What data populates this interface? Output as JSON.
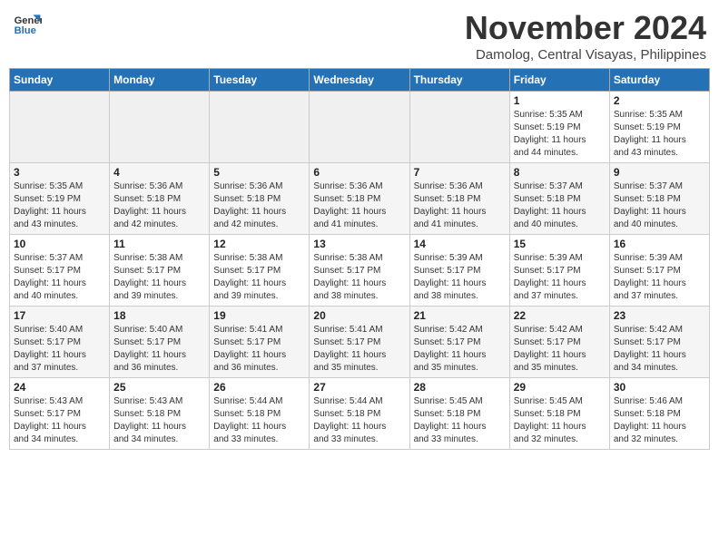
{
  "header": {
    "logo_line1": "General",
    "logo_line2": "Blue",
    "month": "November 2024",
    "location": "Damolog, Central Visayas, Philippines"
  },
  "weekdays": [
    "Sunday",
    "Monday",
    "Tuesday",
    "Wednesday",
    "Thursday",
    "Friday",
    "Saturday"
  ],
  "weeks": [
    [
      {
        "day": "",
        "info": ""
      },
      {
        "day": "",
        "info": ""
      },
      {
        "day": "",
        "info": ""
      },
      {
        "day": "",
        "info": ""
      },
      {
        "day": "",
        "info": ""
      },
      {
        "day": "1",
        "info": "Sunrise: 5:35 AM\nSunset: 5:19 PM\nDaylight: 11 hours\nand 44 minutes."
      },
      {
        "day": "2",
        "info": "Sunrise: 5:35 AM\nSunset: 5:19 PM\nDaylight: 11 hours\nand 43 minutes."
      }
    ],
    [
      {
        "day": "3",
        "info": "Sunrise: 5:35 AM\nSunset: 5:19 PM\nDaylight: 11 hours\nand 43 minutes."
      },
      {
        "day": "4",
        "info": "Sunrise: 5:36 AM\nSunset: 5:18 PM\nDaylight: 11 hours\nand 42 minutes."
      },
      {
        "day": "5",
        "info": "Sunrise: 5:36 AM\nSunset: 5:18 PM\nDaylight: 11 hours\nand 42 minutes."
      },
      {
        "day": "6",
        "info": "Sunrise: 5:36 AM\nSunset: 5:18 PM\nDaylight: 11 hours\nand 41 minutes."
      },
      {
        "day": "7",
        "info": "Sunrise: 5:36 AM\nSunset: 5:18 PM\nDaylight: 11 hours\nand 41 minutes."
      },
      {
        "day": "8",
        "info": "Sunrise: 5:37 AM\nSunset: 5:18 PM\nDaylight: 11 hours\nand 40 minutes."
      },
      {
        "day": "9",
        "info": "Sunrise: 5:37 AM\nSunset: 5:18 PM\nDaylight: 11 hours\nand 40 minutes."
      }
    ],
    [
      {
        "day": "10",
        "info": "Sunrise: 5:37 AM\nSunset: 5:17 PM\nDaylight: 11 hours\nand 40 minutes."
      },
      {
        "day": "11",
        "info": "Sunrise: 5:38 AM\nSunset: 5:17 PM\nDaylight: 11 hours\nand 39 minutes."
      },
      {
        "day": "12",
        "info": "Sunrise: 5:38 AM\nSunset: 5:17 PM\nDaylight: 11 hours\nand 39 minutes."
      },
      {
        "day": "13",
        "info": "Sunrise: 5:38 AM\nSunset: 5:17 PM\nDaylight: 11 hours\nand 38 minutes."
      },
      {
        "day": "14",
        "info": "Sunrise: 5:39 AM\nSunset: 5:17 PM\nDaylight: 11 hours\nand 38 minutes."
      },
      {
        "day": "15",
        "info": "Sunrise: 5:39 AM\nSunset: 5:17 PM\nDaylight: 11 hours\nand 37 minutes."
      },
      {
        "day": "16",
        "info": "Sunrise: 5:39 AM\nSunset: 5:17 PM\nDaylight: 11 hours\nand 37 minutes."
      }
    ],
    [
      {
        "day": "17",
        "info": "Sunrise: 5:40 AM\nSunset: 5:17 PM\nDaylight: 11 hours\nand 37 minutes."
      },
      {
        "day": "18",
        "info": "Sunrise: 5:40 AM\nSunset: 5:17 PM\nDaylight: 11 hours\nand 36 minutes."
      },
      {
        "day": "19",
        "info": "Sunrise: 5:41 AM\nSunset: 5:17 PM\nDaylight: 11 hours\nand 36 minutes."
      },
      {
        "day": "20",
        "info": "Sunrise: 5:41 AM\nSunset: 5:17 PM\nDaylight: 11 hours\nand 35 minutes."
      },
      {
        "day": "21",
        "info": "Sunrise: 5:42 AM\nSunset: 5:17 PM\nDaylight: 11 hours\nand 35 minutes."
      },
      {
        "day": "22",
        "info": "Sunrise: 5:42 AM\nSunset: 5:17 PM\nDaylight: 11 hours\nand 35 minutes."
      },
      {
        "day": "23",
        "info": "Sunrise: 5:42 AM\nSunset: 5:17 PM\nDaylight: 11 hours\nand 34 minutes."
      }
    ],
    [
      {
        "day": "24",
        "info": "Sunrise: 5:43 AM\nSunset: 5:17 PM\nDaylight: 11 hours\nand 34 minutes."
      },
      {
        "day": "25",
        "info": "Sunrise: 5:43 AM\nSunset: 5:18 PM\nDaylight: 11 hours\nand 34 minutes."
      },
      {
        "day": "26",
        "info": "Sunrise: 5:44 AM\nSunset: 5:18 PM\nDaylight: 11 hours\nand 33 minutes."
      },
      {
        "day": "27",
        "info": "Sunrise: 5:44 AM\nSunset: 5:18 PM\nDaylight: 11 hours\nand 33 minutes."
      },
      {
        "day": "28",
        "info": "Sunrise: 5:45 AM\nSunset: 5:18 PM\nDaylight: 11 hours\nand 33 minutes."
      },
      {
        "day": "29",
        "info": "Sunrise: 5:45 AM\nSunset: 5:18 PM\nDaylight: 11 hours\nand 32 minutes."
      },
      {
        "day": "30",
        "info": "Sunrise: 5:46 AM\nSunset: 5:18 PM\nDaylight: 11 hours\nand 32 minutes."
      }
    ]
  ]
}
